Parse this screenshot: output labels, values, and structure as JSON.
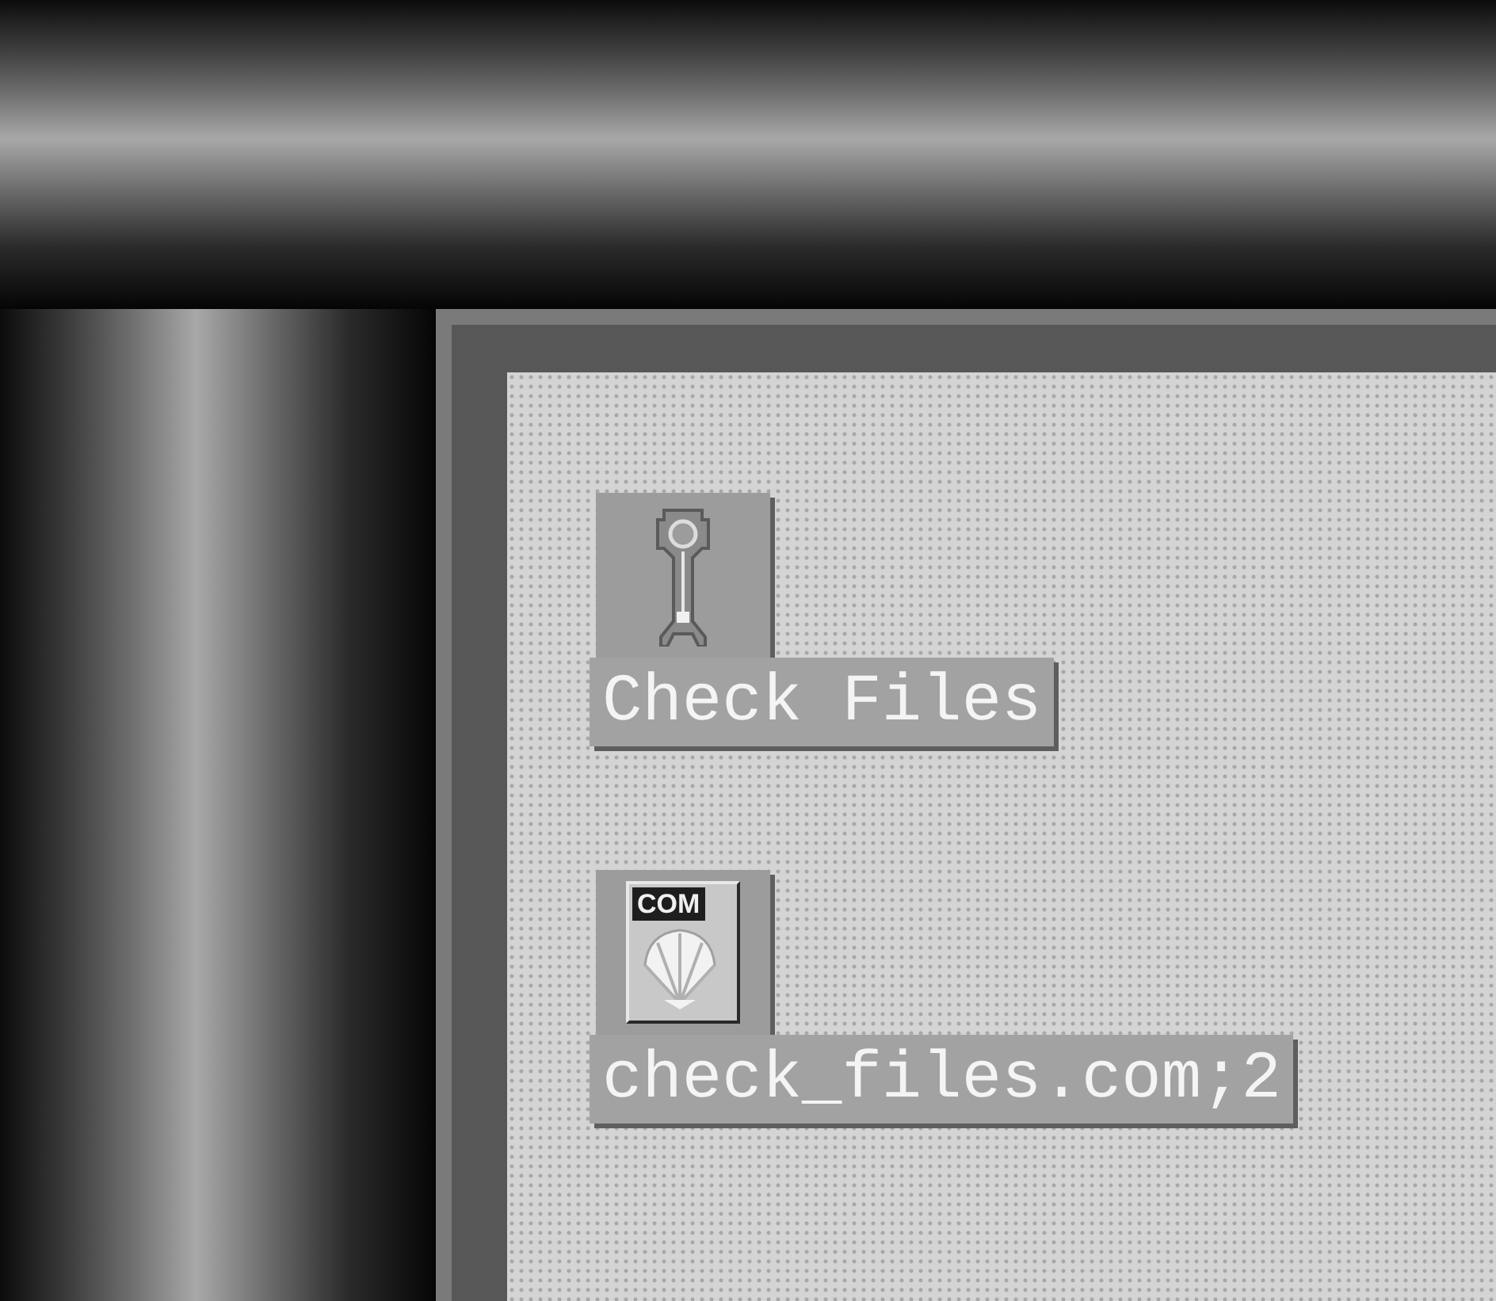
{
  "desktop_icons": [
    {
      "kind": "action",
      "label": "Check Files",
      "selected": true
    },
    {
      "kind": "file",
      "label": "check_files.com;2",
      "badge": "COM",
      "selected": true
    }
  ]
}
